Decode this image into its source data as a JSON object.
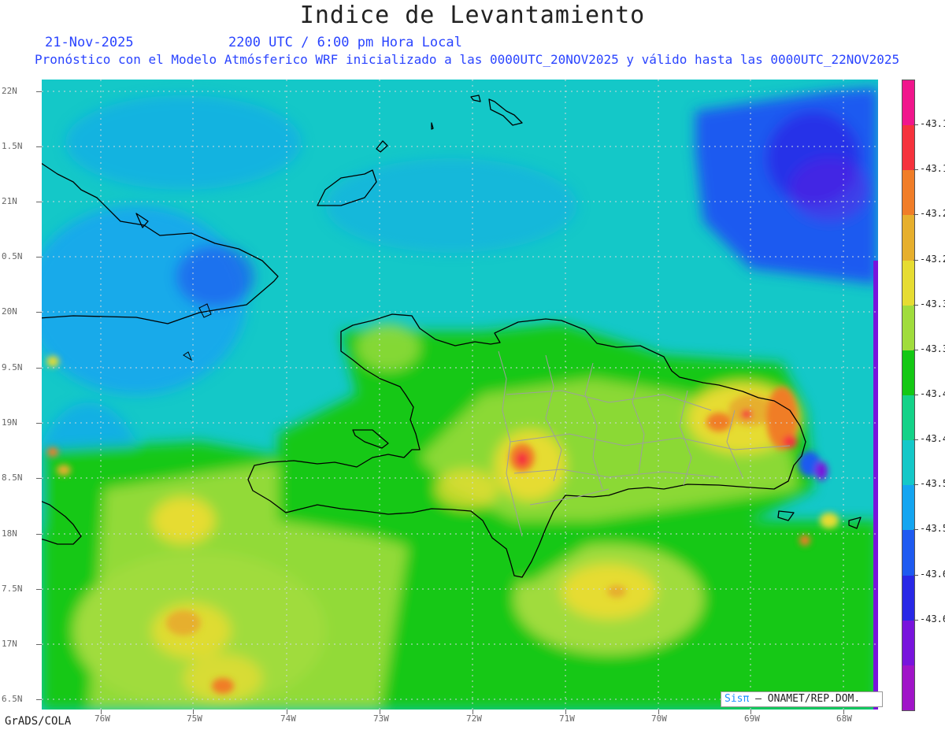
{
  "title": "Indice de Levantamiento",
  "date": "21-Nov-2025",
  "time": "2200 UTC / 6:00 pm Hora Local",
  "forecast": "Pronóstico con el Modelo Atmósferico WRF inicializado a las 0000UTC_20NOV2025 y válido hasta las  0000UTC_22NOV2025",
  "footer": "GrADS/COLA",
  "credit": {
    "brand": "Sisπ",
    "text": " – ONAMET/REP.DOM."
  },
  "map_data": {
    "extent": {
      "lon": [
        -76.2,
        -67.6
      ],
      "lat": [
        16.4,
        22.1
      ]
    },
    "lat_labels": [
      "22N",
      "1.5N",
      "21N",
      "0.5N",
      "20N",
      "9.5N",
      "19N",
      "8.5N",
      "18N",
      "7.5N",
      "17N",
      "6.5N"
    ],
    "lon_labels": [
      "76W",
      "75W",
      "74W",
      "73W",
      "72W",
      "71W",
      "70W",
      "69W",
      "68W"
    ],
    "features": [
      "Cuba (east)",
      "Bahamas / Turks & Caicos",
      "Haiti",
      "Dominican Republic",
      "Puerto Rico (west)",
      "Jamaica (east)"
    ]
  },
  "colorbar": {
    "labels": [
      "-43.1",
      "-43.1",
      "-43.2",
      "-43.2",
      "-43.3",
      "-43.3",
      "-43.4",
      "-43.4",
      "-43.5",
      "-43.5",
      "-43.6",
      "-43.6"
    ],
    "colors": [
      "#f0168c",
      "#f5323c",
      "#f07d28",
      "#e6af2d",
      "#e6dc32",
      "#a0dc3c",
      "#14c814",
      "#14d288",
      "#14c8c8",
      "#14a5f0",
      "#1e5af0",
      "#2828e6",
      "#7814dc",
      "#a014c8"
    ]
  }
}
